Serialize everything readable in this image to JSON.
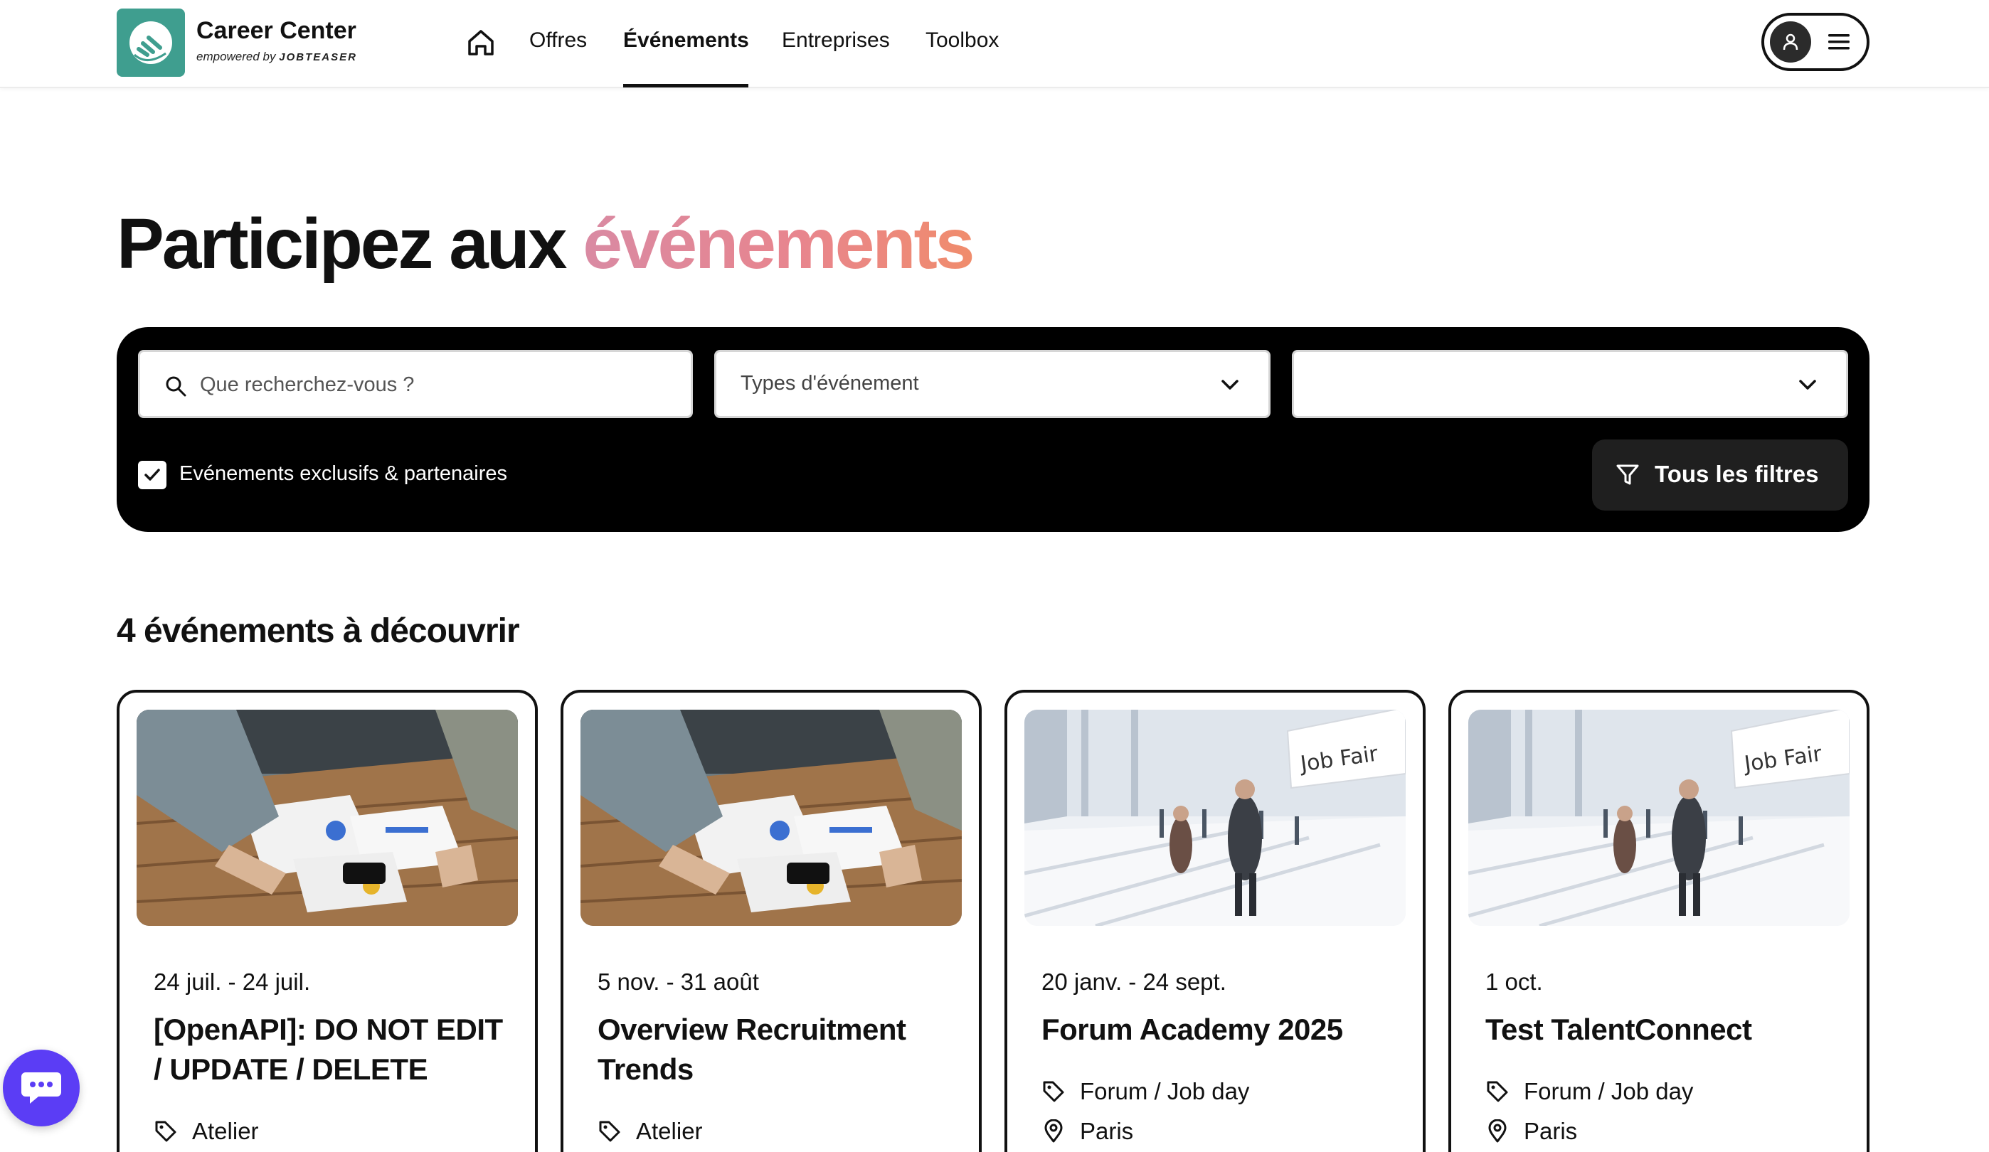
{
  "header": {
    "brand_title": "Career Center",
    "brand_sub_prefix": "empowered by",
    "brand_sub_name": "JOBTEASER",
    "nav": [
      {
        "label": "Offres"
      },
      {
        "label": "Événements",
        "active": true
      },
      {
        "label": "Entreprises"
      },
      {
        "label": "Toolbox"
      }
    ]
  },
  "hero": {
    "title_plain": "Participez aux",
    "title_accent": "événements"
  },
  "search": {
    "placeholder": "Que recherchez-vous ?",
    "type_select": "Types d'événement",
    "location_select": "",
    "exclusive_checkbox": {
      "label": "Evénements exclusifs & partenaires",
      "checked": true
    },
    "filters_button": "Tous les filtres"
  },
  "results": {
    "count_label": "4 événements à découvrir",
    "cards": [
      {
        "date": "24 juil. - 24 juil.",
        "title": "[OpenAPI]: DO NOT EDIT / UPDATE / DELETE",
        "type": "Atelier",
        "location": "",
        "image": "office-meeting-photo"
      },
      {
        "date": "5 nov. - 31 août",
        "title": "Overview Recruitment Trends",
        "type": "Atelier",
        "location": "",
        "image": "office-meeting-photo"
      },
      {
        "date": "20 janv. - 24 sept.",
        "title": "Forum Academy 2025",
        "type": "Forum / Job day",
        "location": "Paris",
        "image": "job-fair-photo",
        "sign": "Job Fair"
      },
      {
        "date": "1 oct.",
        "title": "Test TalentConnect",
        "type": "Forum / Job day",
        "location": "Paris",
        "image": "job-fair-photo",
        "sign": "Job Fair"
      }
    ]
  },
  "colors": {
    "accent_gradient_start": "#d98aa3",
    "accent_gradient_end": "#f08c6c",
    "logo_bg": "#3f9e8f",
    "chat_bg": "#5b3df5"
  }
}
